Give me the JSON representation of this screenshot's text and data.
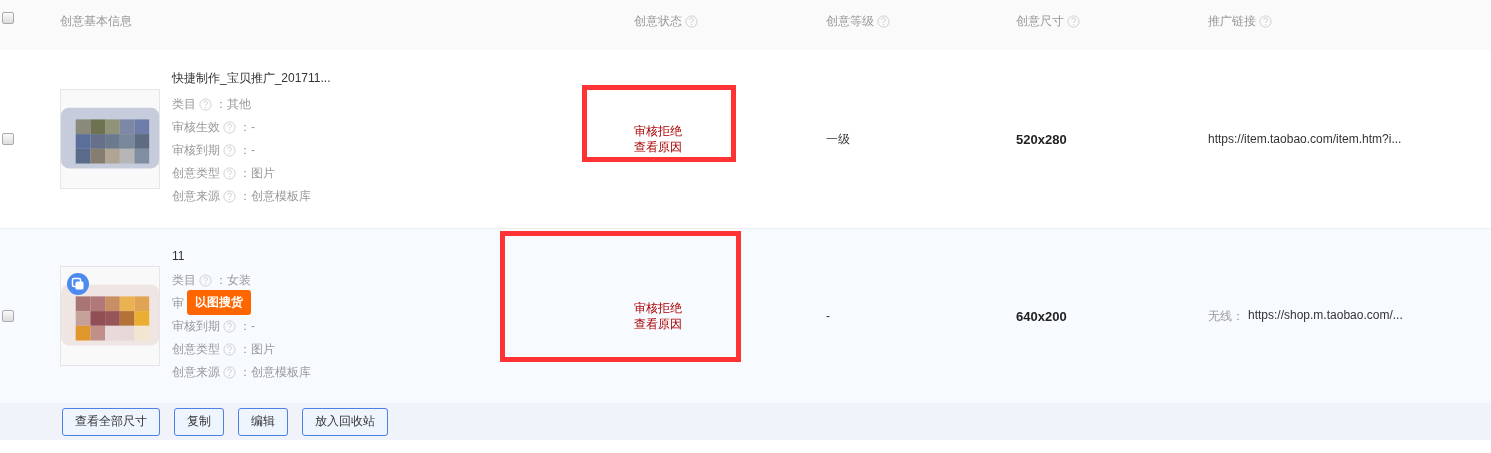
{
  "header": {
    "columns": [
      {
        "label": "创意基本信息",
        "help": false
      },
      {
        "label": "创意状态",
        "help": true
      },
      {
        "label": "创意等级",
        "help": true
      },
      {
        "label": "创意尺寸",
        "help": true
      },
      {
        "label": "推广链接",
        "help": true
      }
    ],
    "checked": false
  },
  "rows": [
    {
      "checked": false,
      "title": "快捷制作_宝贝推广_201711...",
      "copy_icon": false,
      "fields": [
        {
          "kind": "full",
          "label": "类目",
          "value": "：其他"
        },
        {
          "kind": "full",
          "label": "审核生效",
          "value": "：-"
        },
        {
          "kind": "full",
          "label": "审核到期",
          "value": "：-"
        },
        {
          "kind": "full",
          "label": "创意类型",
          "value": "：图片"
        },
        {
          "kind": "full",
          "label": "创意来源",
          "value": "：创意模板库"
        }
      ],
      "status": [
        "审核拒绝",
        "查看原因"
      ],
      "highlighted": true,
      "level": "一级",
      "size": "520x280",
      "link": "https://item.taobao.com/item.htm?i..."
    },
    {
      "checked": false,
      "title": "11",
      "copy_icon": true,
      "badge": "以图搜货",
      "fields": [
        {
          "kind": "full",
          "label": "类目",
          "value": "：女装"
        },
        {
          "kind": "partial",
          "label": "审"
        },
        {
          "kind": "full",
          "label": "审核到期",
          "value": "：-"
        },
        {
          "kind": "full",
          "label": "创意类型",
          "value": "：图片"
        },
        {
          "kind": "full",
          "label": "创意来源",
          "value": "：创意模板库"
        }
      ],
      "status": [
        "审核拒绝",
        "查看原因"
      ],
      "highlighted": true,
      "level": "-",
      "size": "640x200",
      "link_label": "无线：",
      "link": "https://shop.m.taobao.com/..."
    }
  ],
  "actions": [
    "查看全部尺寸",
    "复制",
    "编辑",
    "放入回收站"
  ]
}
